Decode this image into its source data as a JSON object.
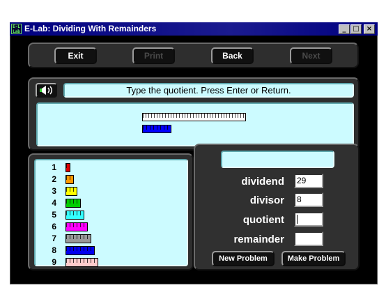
{
  "window": {
    "title": "E-Lab: Dividing With Remainders",
    "icon_text_top": "E-L",
    "icon_text_bottom": "Lab",
    "controls": {
      "minimize": "_",
      "maximize": "□",
      "close": "×"
    }
  },
  "toolbar": {
    "exit": "Exit",
    "print": "Print",
    "back": "Back",
    "next": "Next"
  },
  "instruction": "Type the quotient.  Press Enter or Return.",
  "problem_rods": {
    "long_rod_color": "#ffffff",
    "divisor_rod_color": "#0000ff"
  },
  "rods": [
    {
      "label": "1",
      "color": "#dd0000"
    },
    {
      "label": "2",
      "color": "#ff9900"
    },
    {
      "label": "3",
      "color": "#ffff00"
    },
    {
      "label": "4",
      "color": "#00cc00"
    },
    {
      "label": "5",
      "color": "#33ffff"
    },
    {
      "label": "6",
      "color": "#ff00ff"
    },
    {
      "label": "7",
      "color": "#999999"
    },
    {
      "label": "8",
      "color": "#0000ee"
    },
    {
      "label": "9",
      "color": "#ffcccc"
    }
  ],
  "form": {
    "dividend_label": "dividend",
    "dividend_value": "29",
    "divisor_label": "divisor",
    "divisor_value": "8",
    "quotient_label": "quotient",
    "quotient_value": "",
    "remainder_label": "remainder",
    "remainder_value": "",
    "message": ""
  },
  "actions": {
    "new_problem": "New Problem",
    "make_problem": "Make Problem"
  },
  "colors": {
    "panel_cyan": "#ccfbff",
    "title_blue": "#000080"
  }
}
